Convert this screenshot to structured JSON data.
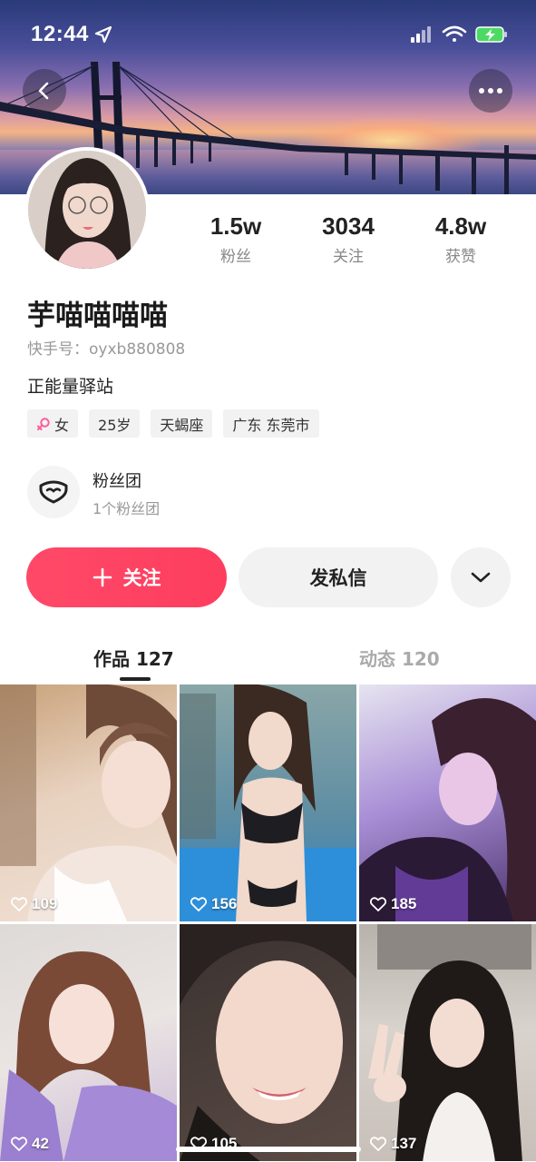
{
  "status_bar": {
    "time": "12:44",
    "icons": [
      "location-arrow-icon",
      "cellular-signal-icon",
      "wifi-icon",
      "battery-charging-icon"
    ]
  },
  "header": {
    "back_icon": "chevron-left-icon",
    "more_icon": "more-dots-icon"
  },
  "profile": {
    "name": "芋喵喵喵喵",
    "id_text": "快手号：oyxb880808",
    "bio": "正能量驿站",
    "stats": [
      {
        "value": "1.5w",
        "label": "粉丝"
      },
      {
        "value": "3034",
        "label": "关注"
      },
      {
        "value": "4.8w",
        "label": "获赞"
      }
    ],
    "tags": {
      "gender": "女",
      "age": "25岁",
      "zodiac": "天蝎座",
      "location": "广东 东莞市"
    },
    "fan_club": {
      "title": "粉丝团",
      "subtitle": "1个粉丝团"
    }
  },
  "actions": {
    "follow_label": "关注",
    "message_label": "发私信"
  },
  "tabs": {
    "works": "作品 127",
    "moments": "动态 120"
  },
  "grid": {
    "items": [
      {
        "likes": "109"
      },
      {
        "likes": "156"
      },
      {
        "likes": "185"
      },
      {
        "likes": "42"
      },
      {
        "likes": "105"
      },
      {
        "likes": "137"
      }
    ]
  },
  "colors": {
    "accent": "#fe4362",
    "tab_inactive": "#aaaaaa",
    "text_secondary": "#999999"
  }
}
